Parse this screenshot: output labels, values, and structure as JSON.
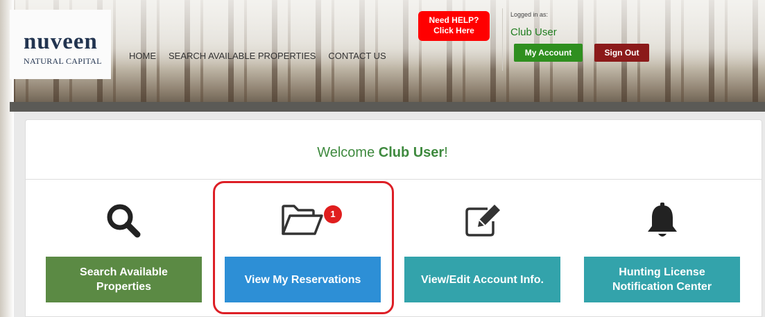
{
  "header": {
    "logo_main": "nuveen",
    "logo_sub": "NATURAL CAPITAL",
    "nav": [
      "HOME",
      "SEARCH AVAILABLE PROPERTIES",
      "CONTACT US"
    ],
    "help_line1": "Need HELP?",
    "help_line2": "Click Here",
    "logged_in_label": "Logged in as:",
    "user_name": "Club User",
    "my_account": "My Account",
    "sign_out": "Sign Out"
  },
  "main": {
    "welcome_prefix": "Welcome ",
    "welcome_name": "Club User",
    "welcome_suffix": "!",
    "reservations_badge": "1",
    "actions": [
      {
        "label": "Search Available Properties",
        "icon": "search-icon",
        "color": "#5b8a44"
      },
      {
        "label": "View My Reservations",
        "icon": "folder-open-icon",
        "color": "#2d8fd6"
      },
      {
        "label": "View/Edit Account Info.",
        "icon": "edit-icon",
        "color": "#33a3ab"
      },
      {
        "label": "Hunting License Notification Center",
        "icon": "bell-icon",
        "color": "#33a3ab"
      }
    ]
  },
  "colors": {
    "help_red": "#ff0000",
    "account_green": "#2f8f1f",
    "signout_red": "#8b1a1a",
    "welcome_green": "#3f8a3f",
    "highlight_red": "#dd1f26"
  }
}
